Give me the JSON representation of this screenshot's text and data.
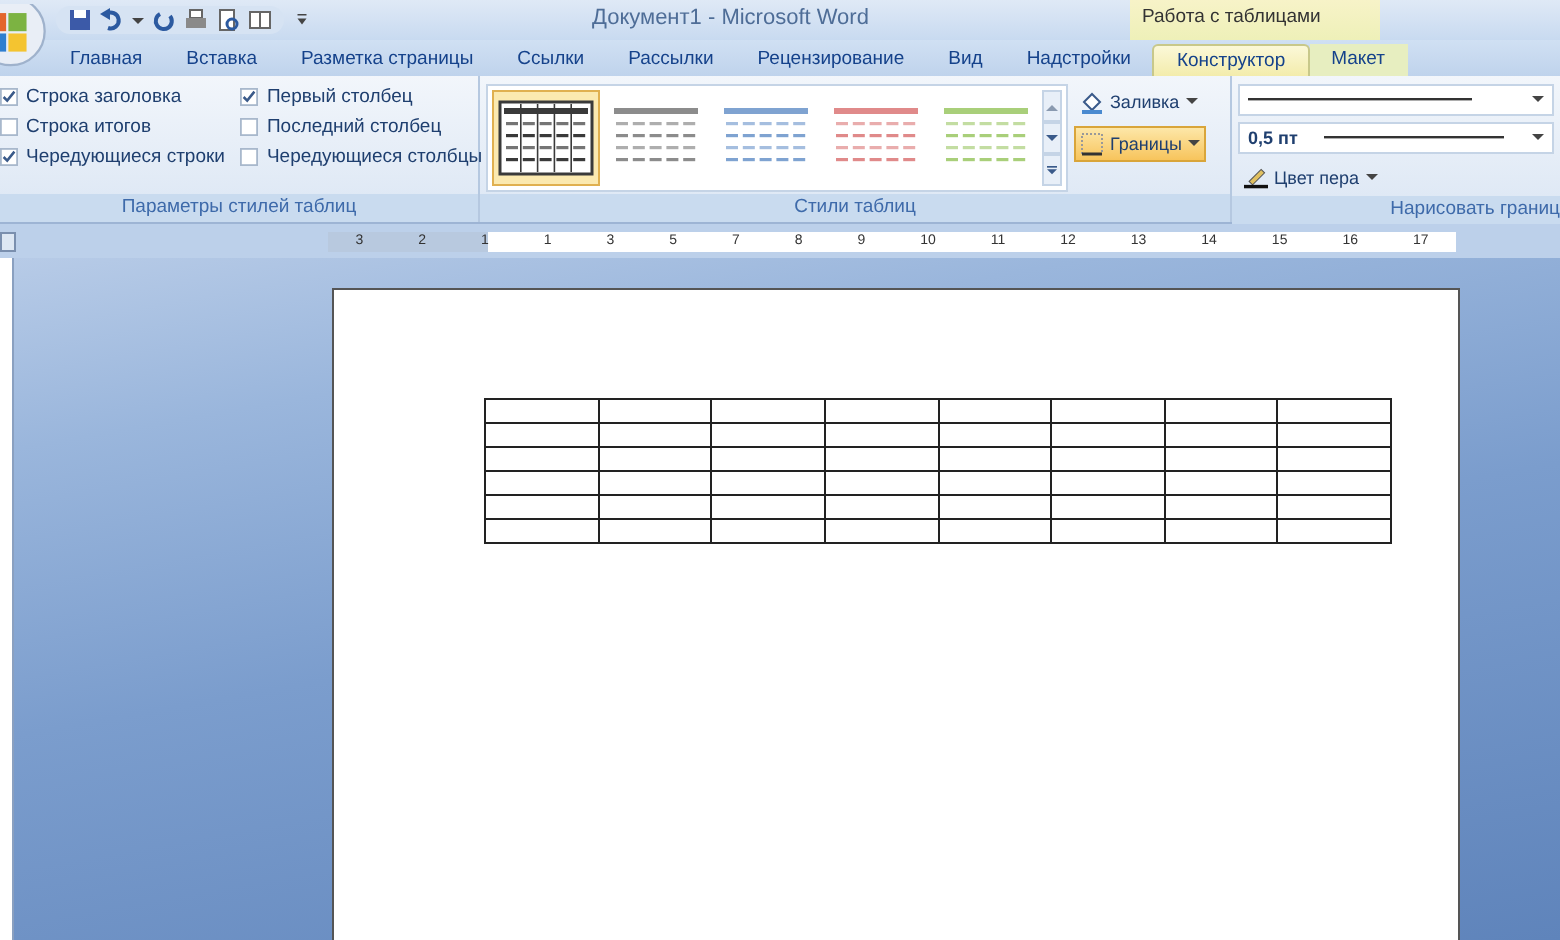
{
  "window": {
    "title": "Документ1 - Microsoft Word"
  },
  "context_tab_group": {
    "label": "Работа с таблицами"
  },
  "tabs": [
    {
      "label": "Главная",
      "selected": false
    },
    {
      "label": "Вставка",
      "selected": false
    },
    {
      "label": "Разметка страницы",
      "selected": false
    },
    {
      "label": "Ссылки",
      "selected": false
    },
    {
      "label": "Рассылки",
      "selected": false
    },
    {
      "label": "Рецензирование",
      "selected": false
    },
    {
      "label": "Вид",
      "selected": false
    },
    {
      "label": "Надстройки",
      "selected": false
    },
    {
      "label": "Конструктор",
      "selected": true
    },
    {
      "label": "Макет",
      "selected": false
    }
  ],
  "style_options": {
    "label": "Параметры стилей таблиц",
    "options": [
      {
        "label": "Строка заголовка",
        "checked": true
      },
      {
        "label": "Строка итогов",
        "checked": false
      },
      {
        "label": "Чередующиеся строки",
        "checked": true
      },
      {
        "label": "Первый столбец",
        "checked": true
      },
      {
        "label": "Последний столбец",
        "checked": false
      },
      {
        "label": "Чередующиеся столбцы",
        "checked": false
      }
    ]
  },
  "table_styles": {
    "label": "Стили таблиц",
    "styles": [
      {
        "color": "#3a3a3a",
        "selected": true
      },
      {
        "color": "#8c8c8c",
        "selected": false
      },
      {
        "color": "#7fa3d1",
        "selected": false
      },
      {
        "color": "#e08a8a",
        "selected": false
      },
      {
        "color": "#a9cf7a",
        "selected": false
      }
    ],
    "shading_button": "Заливка",
    "borders_button": "Границы"
  },
  "draw_borders": {
    "label": "Нарисовать границ",
    "line_weight": "0,5 пт",
    "pen_color_button": "Цвет пера"
  },
  "ruler": {
    "labels": [
      "3",
      "2",
      "1",
      "1",
      "3",
      "5",
      "7",
      "8",
      "9",
      "10",
      "11",
      "12",
      "13",
      "14",
      "15",
      "16",
      "17"
    ]
  }
}
